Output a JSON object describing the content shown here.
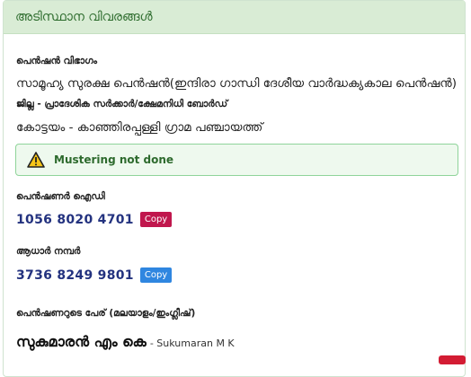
{
  "header": {
    "title": "അടിസ്ഥാന വിവരങ്ങൾ"
  },
  "pension_category": {
    "label": "പെൻഷൻ വിഭാഗം",
    "value": "സാമൂഹ്യ സുരക്ഷ പെൻഷൻ(ഇന്ദിരാ ഗാന്ധി ദേശീയ വാർദ്ധക്യകാല പെൻഷൻ)"
  },
  "district": {
    "label": "ജില്ല - പ്രാദേശിക സർക്കാർ/ക്ഷേമനിധി ബോർഡ്",
    "value": "കോട്ടയം - കാഞ്ഞിരപ്പള്ളി ഗ്രാമ പഞ്ചായത്ത്"
  },
  "alert": {
    "text": "Mustering not done",
    "icon": "warning-icon",
    "color": "#2d6a2d"
  },
  "pensioner_id": {
    "label": "പെൻഷണർ ഐഡി",
    "value": "1056 8020 4701",
    "copy_label": "Copy"
  },
  "aadhaar": {
    "label": "ആധാർ നമ്പർ",
    "value": "3736 8249 9801",
    "copy_label": "Copy"
  },
  "name": {
    "label": "പെൻഷണറുടെ പേര് (മലയാളം/ഇംഗ്ലീഷ്)",
    "malayalam": "സുകുമാരൻ എം കെ",
    "english": "- Sukumaran M K"
  },
  "colors": {
    "header_bg": "#d9ecd5",
    "id_text": "#23327f",
    "copy_red": "#c0174d",
    "copy_blue": "#2f86e0"
  }
}
